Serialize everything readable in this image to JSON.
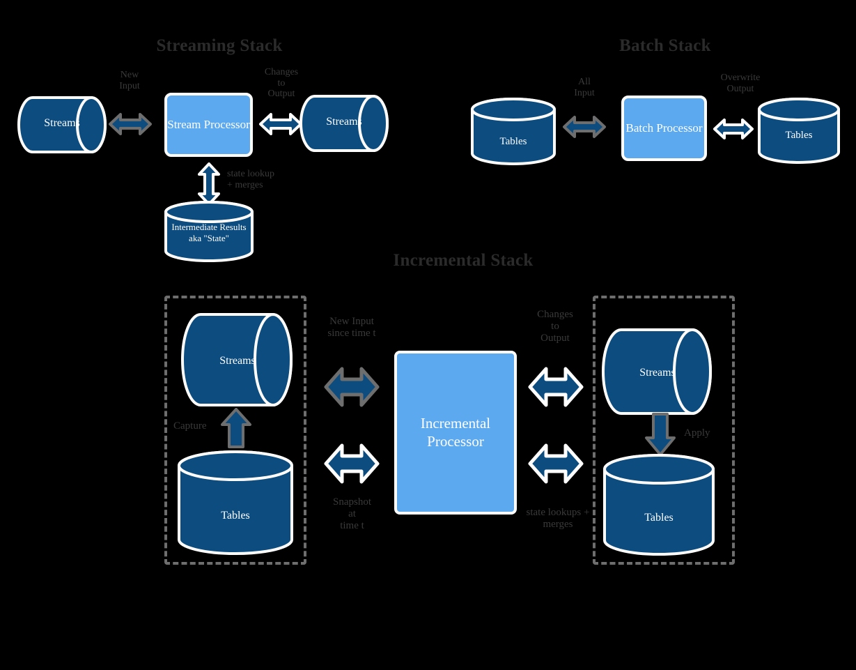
{
  "colors": {
    "background": "#000000",
    "dark_blue": "#0d4c7f",
    "light_blue": "#5ca9f0",
    "white_stroke": "#ffffff",
    "gray_stroke": "#6e6e6e",
    "title_text": "#2b2b2b",
    "label_text": "#3a3a3a"
  },
  "titles": {
    "streaming": "Streaming Stack",
    "batch": "Batch Stack",
    "incremental": "Incremental Stack"
  },
  "streaming_stack": {
    "input_store_label": "Streams",
    "input_connector_label": "New\nInput",
    "processor_label": "Stream\nProcessor",
    "output_connector_label": "Changes\nto\nOutput",
    "output_store_label": "Streams",
    "state_connector_label": "state lookup\n+ merges",
    "state_store_label": "Intermediate\nResults aka\n\"State\""
  },
  "batch_stack": {
    "input_store_label": "Tables",
    "input_connector_label": "All\nInput",
    "processor_label": "Batch\nProcessor",
    "output_connector_label": "Overwrite\nOutput",
    "output_store_label": "Tables"
  },
  "incremental_stack": {
    "source_streams_label": "Streams",
    "source_tables_label": "Tables",
    "capture_label": "Capture",
    "new_input_connector_label": "New Input\nsince time t",
    "snapshot_connector_label": "Snapshot\nat\ntime t",
    "processor_label": "Incremental\nProcessor",
    "changes_connector_label": "Changes\nto\nOutput",
    "state_connector_label": "state lookups +\nmerges",
    "sink_streams_label": "Streams",
    "apply_label": "Apply",
    "sink_tables_label": "Tables"
  }
}
